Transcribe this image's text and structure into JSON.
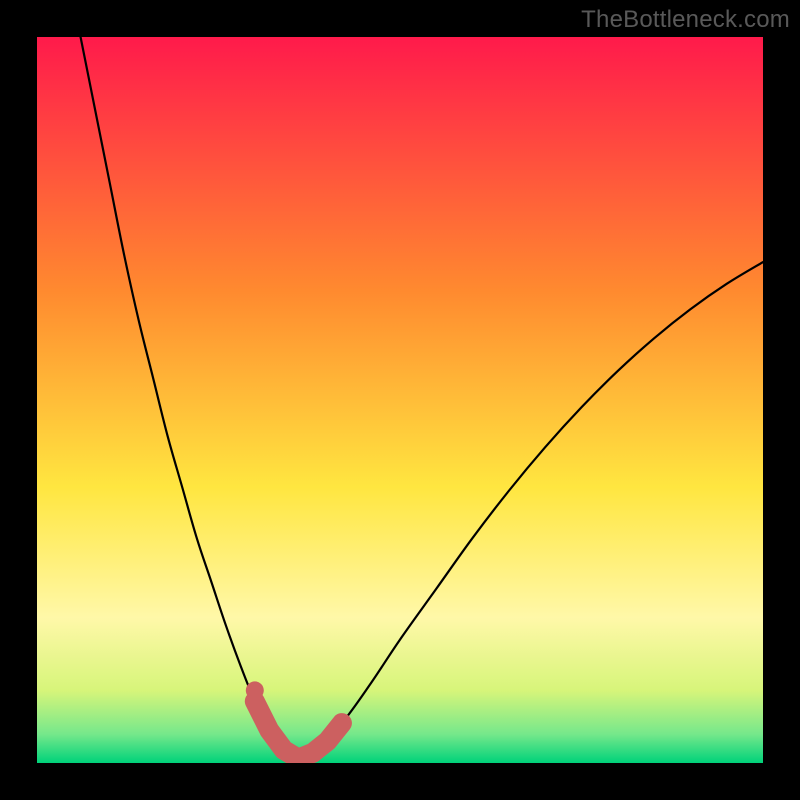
{
  "watermark": "TheBottleneck.com",
  "colors": {
    "frame": "#000000",
    "gradient_top": "#ff1a4b",
    "gradient_mid1": "#ff8a2f",
    "gradient_mid2": "#ffe640",
    "gradient_mid3": "#fff8a8",
    "gradient_low1": "#d7f57a",
    "gradient_low2": "#76e88b",
    "gradient_bottom": "#00d27a",
    "curve": "#000000",
    "marker_fill": "#cc6060",
    "marker_stroke": "#cc6060"
  },
  "chart_data": {
    "type": "line",
    "title": "",
    "xlabel": "",
    "ylabel": "",
    "xlim": [
      0,
      100
    ],
    "ylim": [
      0,
      100
    ],
    "series": [
      {
        "name": "bottleneck-curve",
        "x": [
          6,
          8,
          10,
          12,
          14,
          16,
          18,
          20,
          22,
          24,
          26,
          28,
          30,
          32,
          34,
          36,
          38,
          42,
          46,
          50,
          55,
          60,
          65,
          70,
          75,
          80,
          85,
          90,
          95,
          100
        ],
        "y": [
          100,
          90,
          80,
          70,
          61,
          53,
          45,
          38,
          31,
          25,
          19,
          13.5,
          8.5,
          4.5,
          1.8,
          0.6,
          1.4,
          5.5,
          11,
          17,
          24,
          31,
          37.5,
          43.5,
          49,
          54,
          58.5,
          62.5,
          66,
          69
        ]
      }
    ],
    "markers": {
      "name": "highlight-band",
      "points": [
        {
          "x": 30,
          "y": 8.5
        },
        {
          "x": 32,
          "y": 4.5
        },
        {
          "x": 34,
          "y": 1.8
        },
        {
          "x": 36,
          "y": 0.6
        },
        {
          "x": 38,
          "y": 1.4
        },
        {
          "x": 40,
          "y": 3.0
        },
        {
          "x": 42,
          "y": 5.5
        }
      ],
      "extra_dot": {
        "x": 30,
        "y": 10
      }
    }
  }
}
